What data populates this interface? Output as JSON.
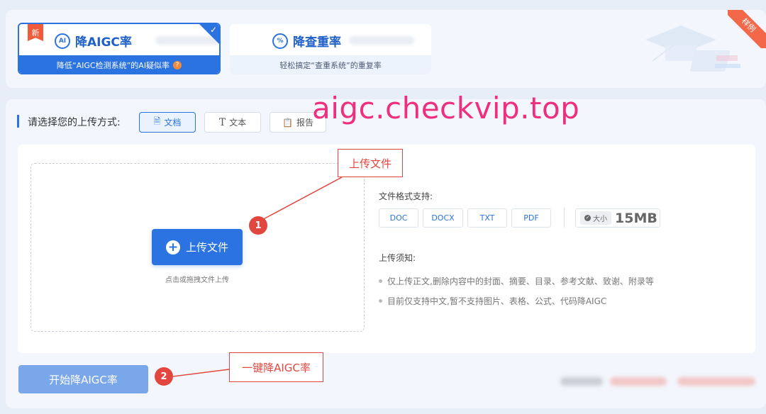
{
  "tabs": {
    "aigc": {
      "new_badge": "新",
      "icon_text": "AI",
      "title": "降AIGC率",
      "subtitle": "降低“AIGC检测系统”的AI疑似率",
      "help_icon": "?"
    },
    "check": {
      "icon_text": "%",
      "title": "降查重率",
      "subtitle": "轻松搞定“查重系统”的重复率"
    }
  },
  "sample_ribbon": "样例",
  "watermark": "aigc.checkvip.top",
  "upload_mode": {
    "label": "请选择您的上传方式:",
    "options": [
      {
        "label": "文档",
        "icon": "document-icon"
      },
      {
        "label": "文本",
        "icon": "text-icon"
      },
      {
        "label": "报告",
        "icon": "report-icon"
      }
    ]
  },
  "dropzone": {
    "button_label": "上传文件",
    "hint": "点击或拖拽文件上传"
  },
  "formats": {
    "label": "文件格式支持:",
    "items": [
      "DOC",
      "DOCX",
      "TXT",
      "PDF"
    ],
    "size_label": "大小",
    "size_value": "15MB"
  },
  "notes": {
    "label": "上传须知:",
    "items": [
      "仅上传正文,删除内容中的封面、摘要、目录、参考文献、致谢、附录等",
      "目前仅支持中文,暂不支持图片、表格、公式、代码降AIGC"
    ]
  },
  "annotations": {
    "upload_label": "上传文件",
    "upload_num": "1",
    "start_label": "一键降AIGC率",
    "start_num": "2"
  },
  "start_button": "开始降AIGC率",
  "colors": {
    "primary": "#2b73e0",
    "annotation": "#e2473f",
    "watermark": "#ee2f7f"
  }
}
